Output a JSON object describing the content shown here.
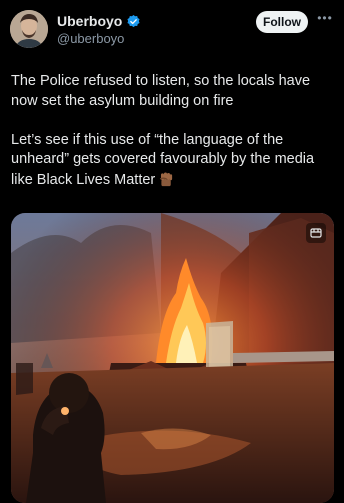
{
  "author": {
    "display_name": "Uberboyo",
    "handle": "@uberboyo",
    "verified": true
  },
  "actions": {
    "follow_label": "Follow",
    "more_icon": "more-horizontal-icon"
  },
  "tweet": {
    "paragraph_1": "The Police refused to listen, so the locals have now set the asylum building on fire",
    "paragraph_2": "Let’s see if this use of “the language of the unheard” gets covered favourably by the media like Black Lives Matter",
    "emoji": "raised-fist-icon"
  },
  "media": {
    "type": "photo",
    "badge_icon": "video-badge-icon"
  },
  "colors": {
    "background": "#000000",
    "text": "#e7e9ea",
    "secondary_text": "#8b98a5",
    "verified_blue": "#1d9bf0",
    "follow_button_bg": "#eff3f4"
  }
}
